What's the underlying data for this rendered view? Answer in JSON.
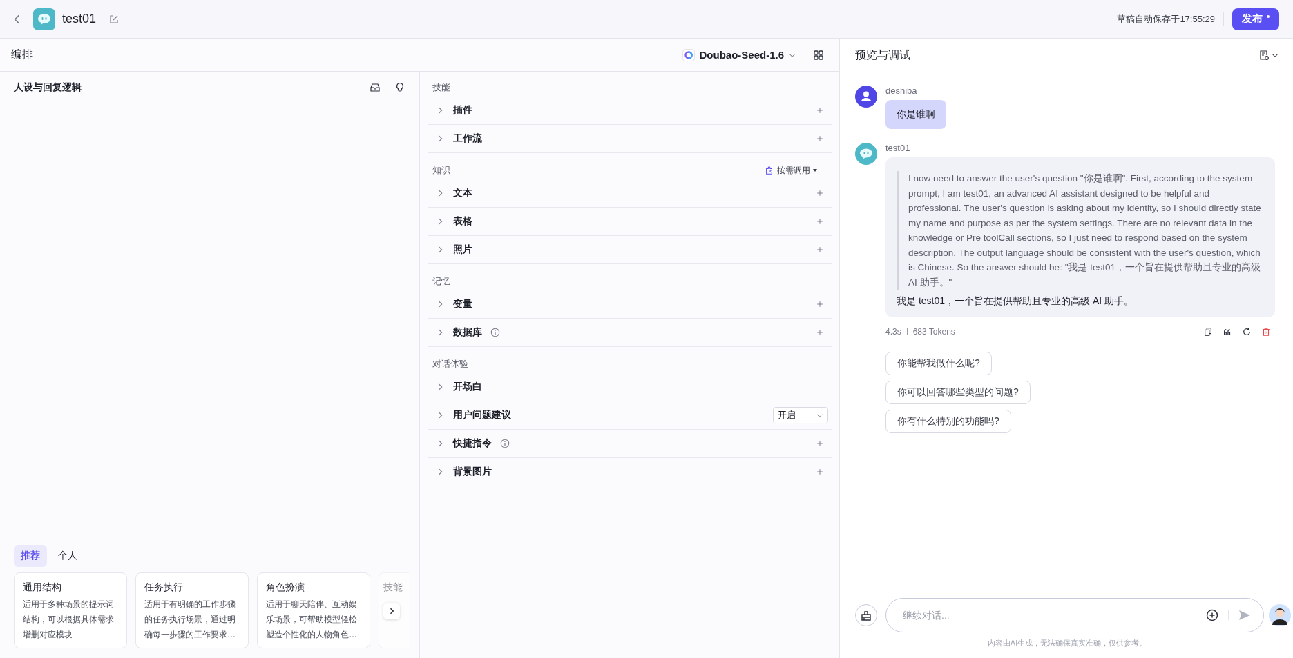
{
  "header": {
    "bot_name": "test01",
    "save_status": "草稿自动保存于17:55:29",
    "publish": "发布"
  },
  "arrange": {
    "title": "编排",
    "model": "Doubao-Seed-1.6"
  },
  "persona": {
    "title": "人设与回复逻辑",
    "template_tabs": [
      {
        "label": "推荐",
        "selected": true
      },
      {
        "label": "个人",
        "selected": false
      }
    ],
    "templates": [
      {
        "title": "通用结构",
        "desc": "适用于多种场景的提示词结构，可以根据具体需求增删对应模块"
      },
      {
        "title": "任务执行",
        "desc": "适用于有明确的工作步骤的任务执行场景，通过明确每一步骤的工作要求…"
      },
      {
        "title": "角色扮演",
        "desc": "适用于聊天陪伴、互动娱乐场景，可帮助模型轻松塑造个性化的人物角色…"
      },
      {
        "title": "技能",
        "partial": true
      }
    ]
  },
  "sections": [
    {
      "title": "技能",
      "items": [
        {
          "label": "插件",
          "kind": "add"
        },
        {
          "label": "工作流",
          "kind": "add"
        }
      ]
    },
    {
      "title": "知识",
      "mode": "按需调用",
      "items": [
        {
          "label": "文本",
          "kind": "add"
        },
        {
          "label": "表格",
          "kind": "add"
        },
        {
          "label": "照片",
          "kind": "add"
        }
      ]
    },
    {
      "title": "记忆",
      "items": [
        {
          "label": "变量",
          "kind": "add"
        },
        {
          "label": "数据库",
          "kind": "add",
          "info": true
        }
      ]
    },
    {
      "title": "对话体验",
      "items": [
        {
          "label": "开场白",
          "kind": "plain"
        },
        {
          "label": "用户问题建议",
          "kind": "select",
          "value": "开启"
        },
        {
          "label": "快捷指令",
          "kind": "add",
          "info": true
        },
        {
          "label": "背景图片",
          "kind": "add"
        }
      ]
    }
  ],
  "preview": {
    "title": "预览与调试",
    "messages": [
      {
        "kind": "user",
        "sender": "deshiba",
        "text": "你是谁啊"
      },
      {
        "kind": "bot",
        "sender": "test01",
        "reasoning": "I now need to answer the user's question \"你是谁啊\". First, according to the system prompt, I am test01, an advanced AI assistant designed to be helpful and professional. The user's question is asking about my identity, so I should directly state my name and purpose as per the system settings. There are no relevant data in the knowledge or Pre toolCall sections, so I just need to respond based on the system description. The output language should be consistent with the user's question, which is Chinese. So the answer should be: \"我是 test01，一个旨在提供帮助且专业的高级 AI 助手。\"",
        "text": "我是 test01，一个旨在提供帮助且专业的高级 AI 助手。",
        "time": "4.3s",
        "tokens": "683 Tokens"
      }
    ],
    "suggestions": [
      "你能帮我做什么呢?",
      "你可以回答哪些类型的问题?",
      "你有什么特别的功能吗?"
    ],
    "input_placeholder": "继续对话...",
    "disclaimer": "内容由AI生成，无法确保真实准确，仅供参考。"
  }
}
